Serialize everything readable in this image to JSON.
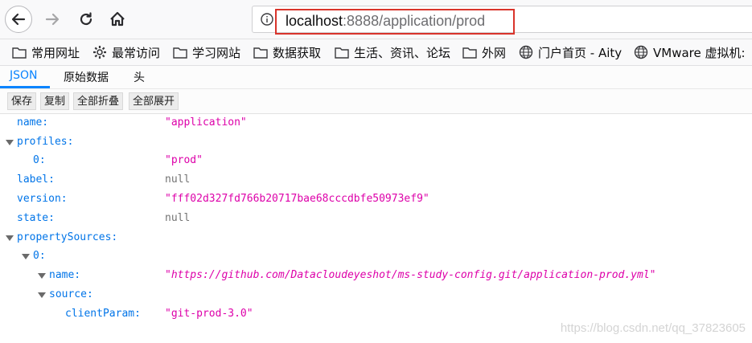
{
  "browser": {
    "url_host": "localhost",
    "url_rest": ":8888/application/prod"
  },
  "bookmarks": [
    {
      "icon": "folder-icon",
      "label": "常用网址"
    },
    {
      "icon": "gear-icon",
      "label": "最常访问"
    },
    {
      "icon": "folder-icon",
      "label": "学习网站"
    },
    {
      "icon": "folder-icon",
      "label": "数据获取"
    },
    {
      "icon": "folder-icon",
      "label": "生活、资讯、论坛"
    },
    {
      "icon": "folder-icon",
      "label": "外网"
    },
    {
      "icon": "globe-icon",
      "label": "门户首页 - Aity"
    },
    {
      "icon": "globe-icon",
      "label": "VMware 虚拟机:"
    }
  ],
  "viewer": {
    "tabs": [
      "JSON",
      "原始数据",
      "头"
    ],
    "active_tab": "JSON",
    "toolbar": [
      "保存",
      "复制",
      "全部折叠",
      "全部展开"
    ]
  },
  "tree": [
    {
      "key": "name:",
      "value": "\"application\"",
      "type": "string"
    },
    {
      "key": "profiles:",
      "value": "",
      "type": "object"
    },
    {
      "key": "0:",
      "value": "\"prod\"",
      "type": "string"
    },
    {
      "key": "label:",
      "value": "null",
      "type": "null"
    },
    {
      "key": "version:",
      "value": "\"fff02d327fd766b20717bae68cccdbfe50973ef9\"",
      "type": "string"
    },
    {
      "key": "state:",
      "value": "null",
      "type": "null"
    },
    {
      "key": "propertySources:",
      "value": "",
      "type": "object"
    },
    {
      "key": "0:",
      "value": "",
      "type": "object"
    },
    {
      "key": "name:",
      "value": "\"https://github.com/Datacloudeyeshot/ms-study-config.git/application-prod.yml\"",
      "type": "url"
    },
    {
      "key": "source:",
      "value": "",
      "type": "object"
    },
    {
      "key": "clientParam:",
      "value": "\"git-prod-3.0\"",
      "type": "string"
    }
  ],
  "watermark": "https://blog.csdn.net/qq_37823605",
  "colors": {
    "key": "#0074e8",
    "string": "#dd00a9",
    "null": "#737373",
    "accent": "#0a84ff",
    "url_highlight": "#d9342b"
  }
}
